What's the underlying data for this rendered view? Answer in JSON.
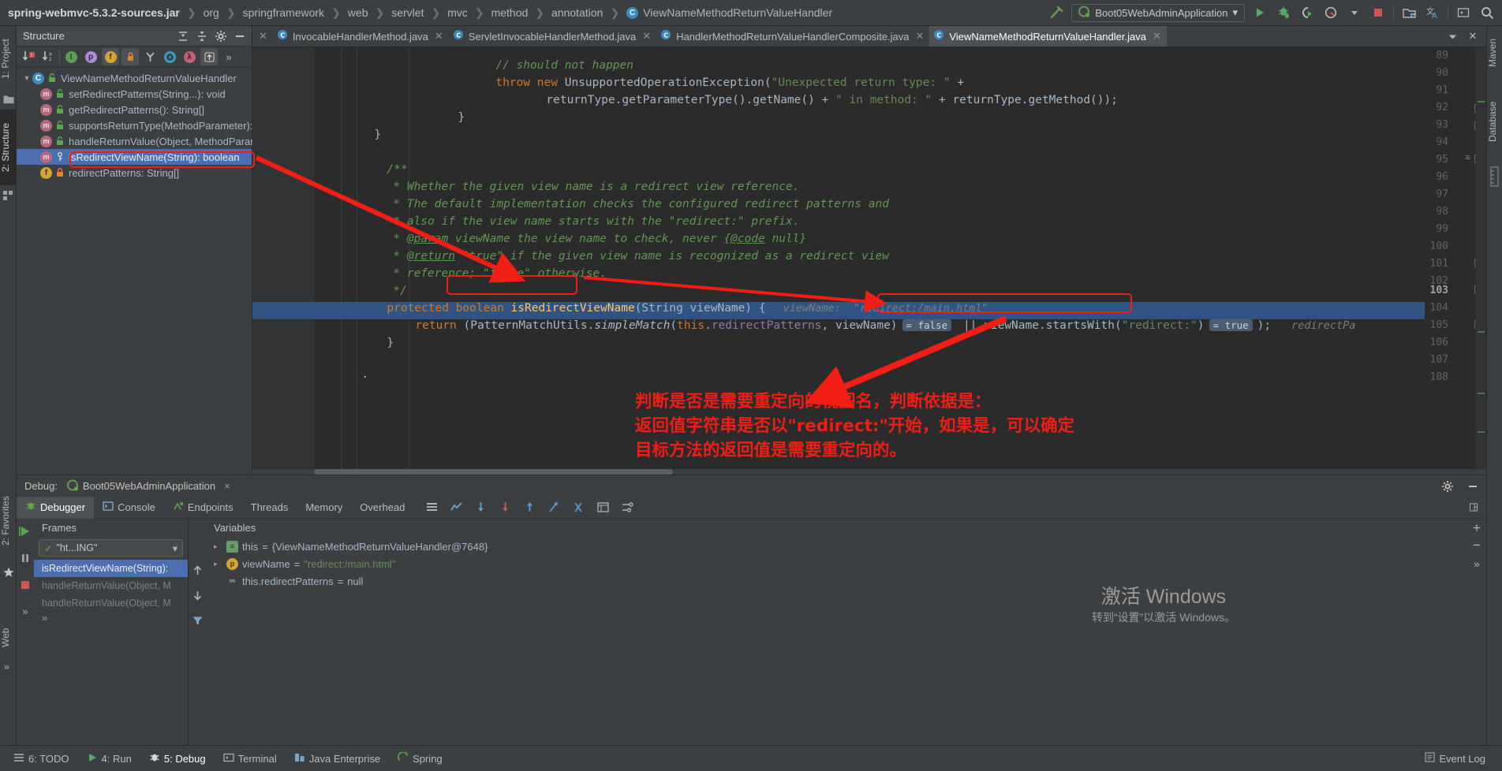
{
  "topbar": {
    "breadcrumb": [
      {
        "label": "spring-webmvc-5.3.2-sources.jar",
        "icon": null
      },
      {
        "label": "org",
        "icon": null
      },
      {
        "label": "springframework",
        "icon": null
      },
      {
        "label": "web",
        "icon": null
      },
      {
        "label": "servlet",
        "icon": null
      },
      {
        "label": "mvc",
        "icon": null
      },
      {
        "label": "method",
        "icon": null
      },
      {
        "label": "annotation",
        "icon": null
      },
      {
        "label": "ViewNameMethodReturnValueHandler",
        "icon": "class-icon"
      }
    ],
    "separator": "❯",
    "class_badge": "C",
    "run_config": "Boot05WebAdminApplication",
    "run_config_dropdown": "▾",
    "icons": [
      "build-hammer-icon",
      "run-icon",
      "debug-icon",
      "run-with-coverage-icon",
      "profiler-icon",
      "profiler-dropdown-icon",
      "stop-icon",
      "project-structure-icon",
      "translate-icon",
      "terminal-icon",
      "search-icon"
    ]
  },
  "left_strip": [
    {
      "label": "1: Project",
      "icon": "project-icon",
      "active": false
    },
    {
      "label": "2: Structure",
      "icon": "structure-icon",
      "active": true
    },
    {
      "label": "folder",
      "icon": "folder-icon",
      "active": false
    },
    {
      "label": "modules",
      "icon": "modules-icon",
      "active": false
    }
  ],
  "right_strip": [
    {
      "label": "Maven",
      "icon": "maven-icon"
    },
    {
      "label": "Database",
      "icon": "database-icon"
    }
  ],
  "structure": {
    "title": "Structure",
    "header_icons": [
      "expand-all-icon",
      "collapse-all-icon",
      "settings-gear-icon",
      "hide-icon"
    ],
    "toolbar": [
      {
        "name": "sort-by-visibility-icon",
        "label": "↓",
        "badge": "■",
        "badge_color": "#cc5252",
        "on": false
      },
      {
        "name": "sort-alphabetically-icon",
        "label": "↓",
        "badge": "az",
        "badge_color": "#b0b0b0",
        "on": false
      },
      {
        "name": "show-inherited-icon",
        "label": "I",
        "badge_color": "#59a869",
        "on": false
      },
      {
        "name": "show-properties-icon",
        "label": "p",
        "badge_color": "#b08cd9",
        "on": false
      },
      {
        "name": "show-fields-icon",
        "label": "f",
        "badge_color": "#d4a437",
        "on": true
      },
      {
        "name": "show-non-public-icon",
        "label": "■",
        "badge_color": "#e08330",
        "on": true
      },
      {
        "name": "group-by-icon",
        "label": "Y",
        "badge_color": "#a0a0a0",
        "on": false
      },
      {
        "name": "show-anonymous-icon",
        "label": "O",
        "badge_color": "#3b9bc8",
        "on": false
      },
      {
        "name": "show-lambdas-icon",
        "label": "λ",
        "badge_color": "#c1607a",
        "on": false
      },
      {
        "name": "autoscroll-icon",
        "label": "⤒",
        "badge_color": "#9aa0a6",
        "on": true
      },
      {
        "name": "more-icon",
        "label": "»",
        "badge_color": "#9aa0a6",
        "on": false
      }
    ],
    "tree": [
      {
        "label": "ViewNameMethodReturnValueHandler",
        "kind": "class",
        "icon": "class-icon",
        "visibility": "public",
        "depth": 0,
        "expanded": true,
        "selected": false
      },
      {
        "label": "setRedirectPatterns(String...): void",
        "kind": "method",
        "icon": "method-icon",
        "visibility": "public",
        "depth": 1,
        "selected": false
      },
      {
        "label": "getRedirectPatterns(): String[]",
        "kind": "method",
        "icon": "method-icon",
        "visibility": "public",
        "depth": 1,
        "selected": false
      },
      {
        "label": "supportsReturnType(MethodParameter): boolean",
        "kind": "method",
        "icon": "method-icon",
        "visibility": "public",
        "depth": 1,
        "selected": false
      },
      {
        "label": "handleReturnValue(Object, MethodParameter, ModelAndViewContainer, NativeWebRequest): void",
        "kind": "method",
        "icon": "method-icon",
        "visibility": "public",
        "depth": 1,
        "selected": false
      },
      {
        "label": "isRedirectViewName(String): boolean",
        "kind": "method",
        "icon": "method-icon",
        "visibility": "protected",
        "depth": 1,
        "selected": true
      },
      {
        "label": "redirectPatterns: String[]",
        "kind": "field",
        "icon": "field-icon",
        "visibility": "private",
        "depth": 1,
        "selected": false
      }
    ]
  },
  "editor_tabs": [
    {
      "label": "InvocableHandlerMethod.java",
      "icon": "java-class-icon",
      "active": false,
      "closable": true
    },
    {
      "label": "ServletInvocableHandlerMethod.java",
      "icon": "java-class-icon",
      "active": false,
      "closable": true
    },
    {
      "label": "HandlerMethodReturnValueHandlerComposite.java",
      "icon": "java-class-icon",
      "active": false,
      "closable": true
    },
    {
      "label": "ViewNameMethodReturnValueHandler.java",
      "icon": "java-class-icon",
      "active": true,
      "closable": true
    }
  ],
  "editor_tabs_right_icons": [
    "chevron-down-icon",
    "close-icon"
  ],
  "code": {
    "first_visible_line": 89,
    "current_line": 103,
    "highlighted_line": 104,
    "lines": [
      {
        "n": 89,
        "indent": 12,
        "tokens": [
          {
            "t": "// should not happen",
            "c": "cmt"
          }
        ],
        "clipped": true
      },
      {
        "n": 90,
        "indent": 12,
        "tokens": [
          {
            "t": "throw",
            "c": "kw"
          },
          {
            "t": " ",
            "c": "par"
          },
          {
            "t": "new",
            "c": "kw"
          },
          {
            "t": " UnsupportedOperationException(",
            "c": "par"
          },
          {
            "t": "\"Unexpected return type: \"",
            "c": "str"
          },
          {
            "t": " +",
            "c": "par"
          }
        ]
      },
      {
        "n": 91,
        "indent": 20,
        "tokens": [
          {
            "t": "returnType.getParameterType().getName() + ",
            "c": "par"
          },
          {
            "t": "\" in method: \"",
            "c": "str"
          },
          {
            "t": " + returnType.getMethod());",
            "c": "par"
          }
        ]
      },
      {
        "n": 92,
        "indent": 8,
        "tokens": [
          {
            "t": "}",
            "c": "par"
          }
        ],
        "fold": true
      },
      {
        "n": 93,
        "indent": 4,
        "tokens": [
          {
            "t": "}",
            "c": "par"
          }
        ],
        "fold": true
      },
      {
        "n": 94,
        "indent": 0,
        "tokens": []
      },
      {
        "n": 95,
        "indent": 4,
        "tokens": [
          {
            "t": "/**",
            "c": "cmt"
          }
        ],
        "fold": true,
        "gmark": "≡"
      },
      {
        "n": 96,
        "indent": 5,
        "tokens": [
          {
            "t": "* Whether the given view name is a redirect view reference.",
            "c": "cmt"
          }
        ]
      },
      {
        "n": 97,
        "indent": 5,
        "tokens": [
          {
            "t": "* The default implementation checks the configured redirect patterns and",
            "c": "cmt"
          }
        ]
      },
      {
        "n": 98,
        "indent": 5,
        "tokens": [
          {
            "t": "* also if the view name starts with the \"redirect:\" prefix.",
            "c": "cmt"
          }
        ]
      },
      {
        "n": 99,
        "indent": 5,
        "tokens": [
          {
            "t": "* ",
            "c": "cmt"
          },
          {
            "t": "@param",
            "c": "tag"
          },
          {
            "t": " viewName the view name to check, never ",
            "c": "cmt"
          },
          {
            "t": "{@code",
            "c": "tag"
          },
          {
            "t": " null}",
            "c": "cmt"
          }
        ]
      },
      {
        "n": 100,
        "indent": 5,
        "tokens": [
          {
            "t": "* ",
            "c": "cmt"
          },
          {
            "t": "@return",
            "c": "tag"
          },
          {
            "t": " \"true\" if the given view name is recognized as a redirect view",
            "c": "cmt"
          }
        ]
      },
      {
        "n": 101,
        "indent": 5,
        "tokens": [
          {
            "t": "* reference; \"false\" otherwise.",
            "c": "cmt"
          }
        ]
      },
      {
        "n": 102,
        "indent": 5,
        "tokens": [
          {
            "t": "*/",
            "c": "cmt"
          }
        ],
        "fold": true
      },
      {
        "n": 103,
        "indent": 4,
        "tokens": [
          {
            "t": "protected",
            "c": "kw"
          },
          {
            "t": " ",
            "c": "par"
          },
          {
            "t": "boolean",
            "c": "kw"
          },
          {
            "t": " ",
            "c": "par"
          },
          {
            "t": "isRedirectViewName",
            "c": "mth"
          },
          {
            "t": "(",
            "c": "par"
          },
          {
            "t": "String",
            "c": "par"
          },
          {
            "t": " viewName) {",
            "c": "par"
          }
        ],
        "fold": true,
        "hint": "viewName:  \"redirect:/main.html\""
      },
      {
        "n": 104,
        "indent": 8,
        "tokens": [
          {
            "t": "return",
            "c": "kw"
          },
          {
            "t": " (PatternMatchUtils.",
            "c": "par"
          },
          {
            "t": "simpleMatch",
            "c": "meth-i"
          },
          {
            "t": "(",
            "c": "par"
          },
          {
            "t": "this",
            "c": "kw"
          },
          {
            "t": ".",
            "c": "par"
          },
          {
            "t": "redirectPatterns",
            "c": "fld"
          },
          {
            "t": ", viewName)",
            "c": "par"
          }
        ],
        "inlay1": "= false",
        "mid": " || ",
        "tokens2": [
          {
            "t": "viewName.startsWith(",
            "c": "par"
          },
          {
            "t": "\"redirect:\"",
            "c": "str"
          },
          {
            "t": ")",
            "c": "par"
          }
        ],
        "inlay2": "= true",
        "tail": ");",
        "trailing": "redirectPa"
      },
      {
        "n": 105,
        "indent": 4,
        "tokens": [
          {
            "t": "}",
            "c": "par"
          }
        ],
        "fold": true
      },
      {
        "n": 106,
        "indent": 0,
        "tokens": []
      },
      {
        "n": 107,
        "indent": 0,
        "tokens": [
          {
            "t": "·",
            "c": "par"
          }
        ]
      },
      {
        "n": 108,
        "indent": 0,
        "tokens": []
      }
    ],
    "inlay_false": "= false",
    "inlay_true": "= true",
    "inline_hint_103": "viewName:  \"redirect:/main.html\"",
    "trailing_hint_104": "redirectPa"
  },
  "annotation": {
    "color": "#f01e14",
    "note_lines": [
      "判断是否是需要重定向的视图名，判断依据是：",
      "返回值字符串是否以\"redirect:\"开始，如果是，可以确定",
      "目标方法的返回值是需要重定向的。"
    ]
  },
  "debug": {
    "label": "Debug:",
    "config": "Boot05WebAdminApplication",
    "config_close": "×",
    "header_icons": [
      "settings-gear-icon",
      "minimize-icon"
    ],
    "tabs": [
      {
        "label": "Debugger",
        "icon": "debugger-icon",
        "active": true
      },
      {
        "label": "Console",
        "icon": "console-icon",
        "active": false
      },
      {
        "label": "Endpoints",
        "icon": "endpoints-icon",
        "active": false
      },
      {
        "label": "Threads",
        "icon": null,
        "active": false
      },
      {
        "label": "Memory",
        "icon": null,
        "active": false
      },
      {
        "label": "Overhead",
        "icon": null,
        "active": false
      }
    ],
    "tab_icons": [
      "layout-icon",
      "chart-icon",
      "step-into-icon",
      "force-step-into-icon",
      "step-out-icon",
      "run-to-cursor-icon",
      "evaluate-icon",
      "watches-icon",
      "settings-icon"
    ],
    "step_icons": [
      "resume-icon",
      "pause-icon",
      "stop-icon",
      "more-icon"
    ],
    "frames": {
      "title": "Frames",
      "thread": "\"ht...ING\"",
      "thread_check": "✓",
      "thread_dropdown": "▾",
      "buttons": [
        "up-icon",
        "down-icon",
        "filter-icon"
      ],
      "items": [
        {
          "label": "isRedirectViewName(String):",
          "selected": true,
          "dim": false
        },
        {
          "label": "handleReturnValue(Object, M",
          "selected": false,
          "dim": true
        },
        {
          "label": "handleReturnValue(Object, M",
          "selected": false,
          "dim": true
        }
      ],
      "more": "»"
    },
    "variables": {
      "title": "Variables",
      "toolbar_icons": [
        "add-icon",
        "remove-icon",
        "more-icon"
      ],
      "rows": [
        {
          "twist": "▸",
          "badge": "≡",
          "badge_color": "#6a9b6a",
          "badge_text_color": "#1f2d1f",
          "name": "this",
          "eq": "=",
          "value": "{ViewNameMethodReturnValueHandler@7648}",
          "value_class": "vval"
        },
        {
          "twist": "▸",
          "badge": "p",
          "badge_color": "#d4a437",
          "badge_text_color": "#4a3500",
          "name": "viewName",
          "eq": "=",
          "value": "\"redirect:/main.html\"",
          "value_class": "vstr"
        },
        {
          "twist": "",
          "badge": "∞",
          "badge_color": "transparent",
          "badge_text_color": "#9aa0a6",
          "name": "this.redirectPatterns",
          "eq": "=",
          "value": "null",
          "value_class": "vval"
        }
      ]
    }
  },
  "statusbar": {
    "items": [
      {
        "label": "6: TODO",
        "icon": "todo-icon",
        "active": false
      },
      {
        "label": "4: Run",
        "icon": "run-icon",
        "active": false
      },
      {
        "label": "5: Debug",
        "icon": "debug-icon",
        "active": true
      },
      {
        "label": "Terminal",
        "icon": "terminal-icon",
        "active": false
      },
      {
        "label": "Java Enterprise",
        "icon": "java-enterprise-icon",
        "active": false
      },
      {
        "label": "Spring",
        "icon": "spring-icon",
        "active": false
      }
    ],
    "right": [
      {
        "label": "Event Log",
        "icon": "event-log-icon"
      }
    ]
  },
  "bottom_left_strip": [
    {
      "label": "2: Favorites",
      "icon": "favorites-icon"
    },
    {
      "label": "Web",
      "icon": "web-icon"
    }
  ],
  "watermark": {
    "line1": "激活 Windows",
    "line2": "转到“设置”以激活 Windows。"
  }
}
